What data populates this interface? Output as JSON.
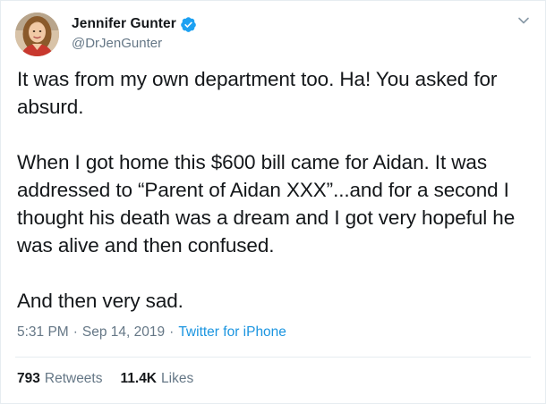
{
  "author": {
    "display_name": "Jennifer Gunter",
    "handle": "@DrJenGunter",
    "verified_icon": "verified-badge-icon",
    "accent_color": "#1da1f2"
  },
  "tweet": {
    "paragraphs": [
      "It was from my own department too. Ha! You asked for absurd.",
      "When I got home this $600 bill came for Aidan. It was addressed to “Parent of Aidan XXX”...and for a second I thought his death was a dream and I got very hopeful he was alive and then confused.",
      "And then very sad."
    ],
    "time": "5:31 PM",
    "date": "Sep 14, 2019",
    "separator": "·",
    "source": "Twitter for iPhone"
  },
  "stats": {
    "retweets_count": "793",
    "retweets_label": "Retweets",
    "likes_count": "11.4K",
    "likes_label": "Likes"
  },
  "menu_icon": "chevron-down-icon"
}
